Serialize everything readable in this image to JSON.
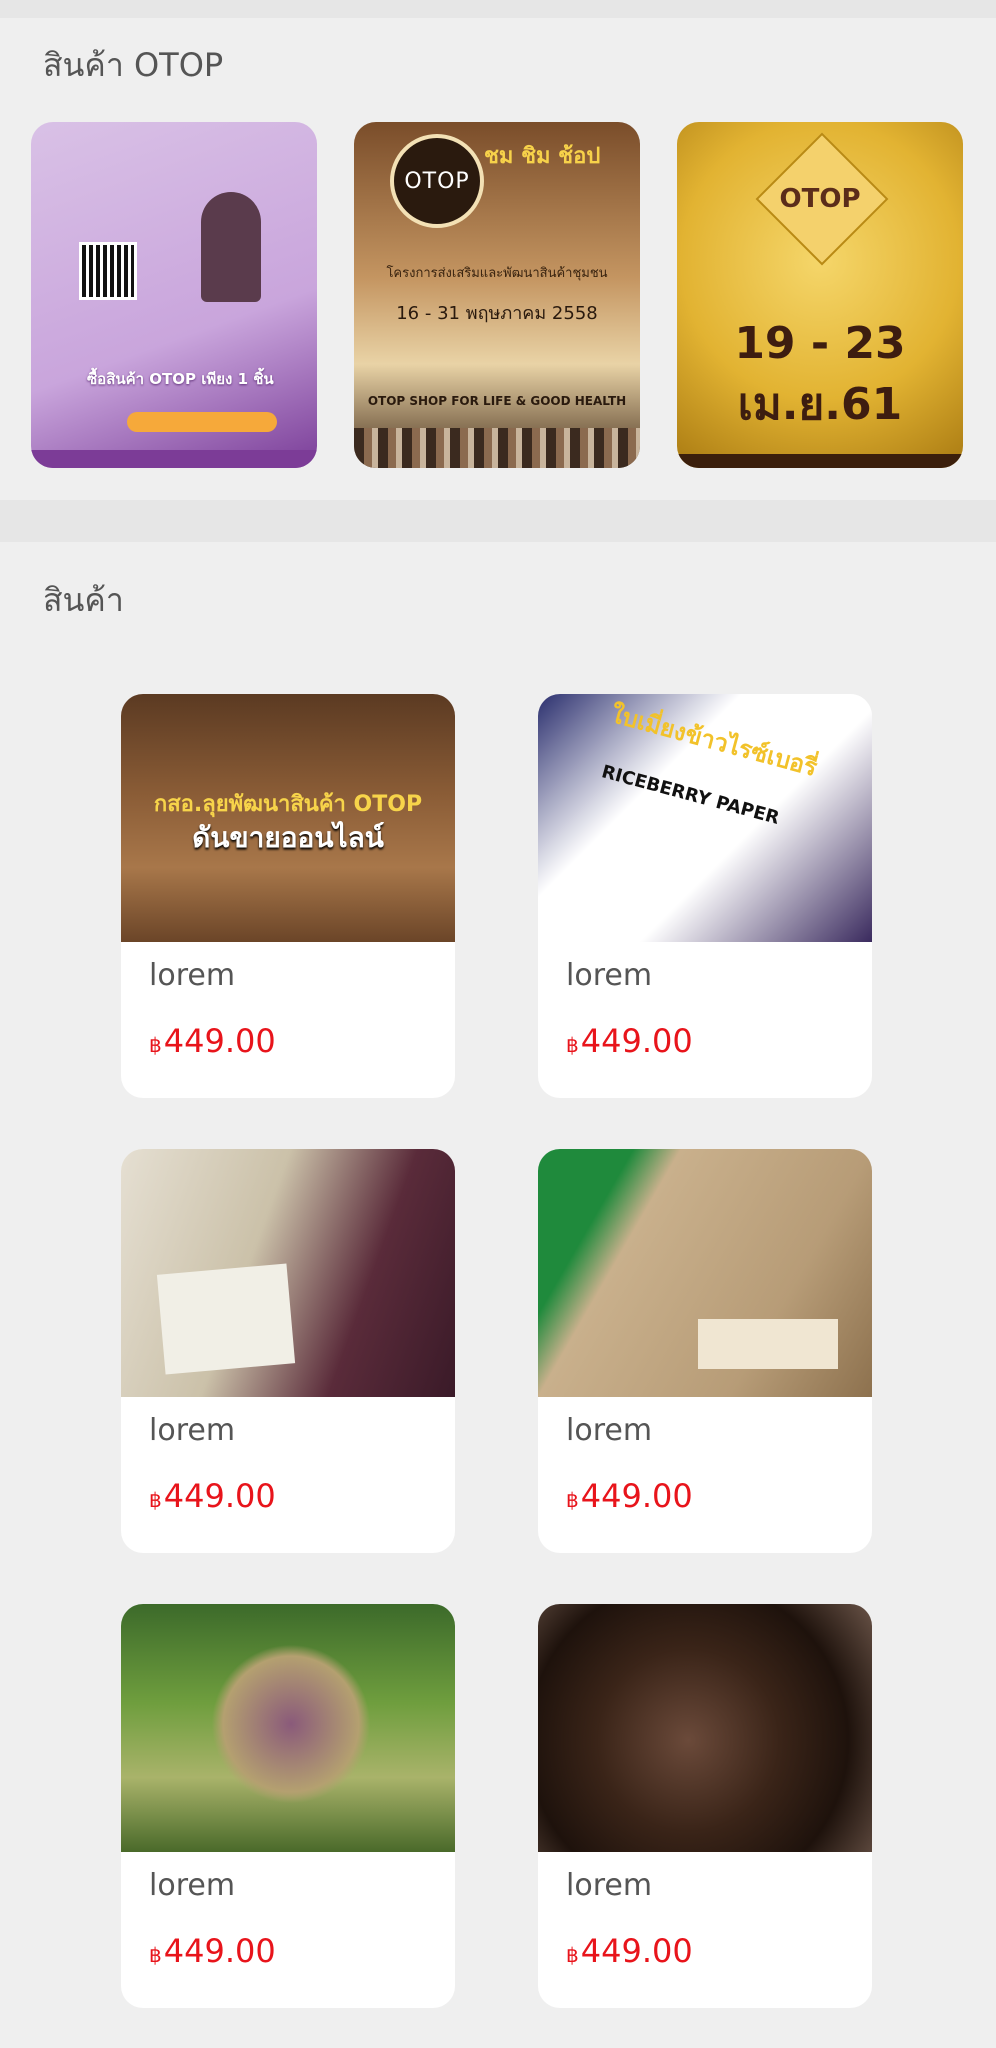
{
  "otop_section": {
    "title": "สินค้า OTOP",
    "banners": [
      {
        "url": "https://shopee.co.th/otop",
        "headline": "ซื้อสินค้า OTOP เพียง 1 ชิ้น"
      },
      {
        "logo": "OTOP",
        "heading": "ชม ชิม ช้อป",
        "project": "โครงการส่งเสริมและพัฒนาสินค้าชุมชน",
        "date": "16 - 31 พฤษภาคม 2558",
        "slogan": "OTOP SHOP FOR LIFE & GOOD HEALTH"
      },
      {
        "logo": "OTOP",
        "date": "19 - 23 เม.ย.61"
      }
    ]
  },
  "products_section": {
    "title": "สินค้า",
    "currency": "฿",
    "items": [
      {
        "name": "lorem",
        "price": "449.00",
        "image_text_1": "กสอ.ลุยพัฒนาสินค้า OTOP",
        "image_text_2": "ดันขายออนไลน์"
      },
      {
        "name": "lorem",
        "price": "449.00",
        "image_text_1": "ใบเมี่ยงข้าวไรซ์เบอรี่",
        "image_text_2": "RICEBERRY PAPER"
      },
      {
        "name": "lorem",
        "price": "449.00"
      },
      {
        "name": "lorem",
        "price": "449.00"
      },
      {
        "name": "lorem",
        "price": "449.00"
      },
      {
        "name": "lorem",
        "price": "449.00"
      }
    ]
  },
  "colors": {
    "price": "#e8141b",
    "page_background": "#efefef",
    "card_background": "#ffffff"
  }
}
